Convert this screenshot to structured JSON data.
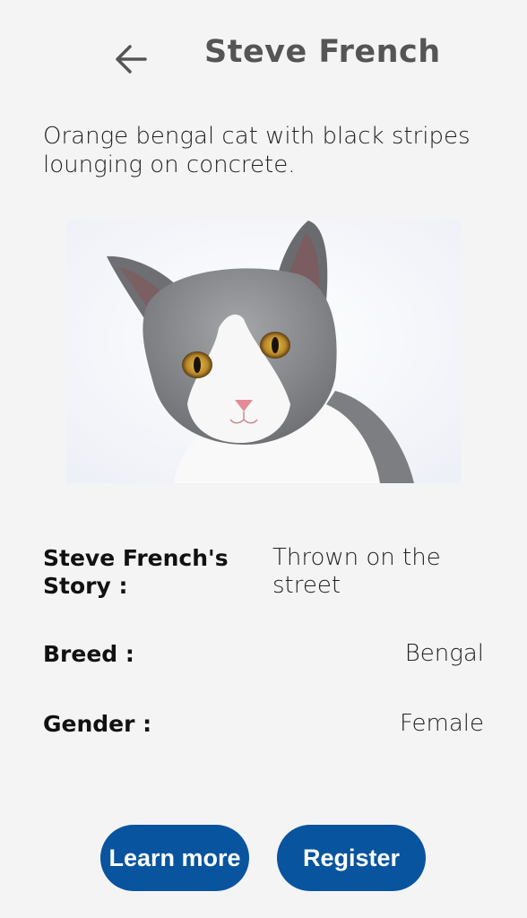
{
  "header": {
    "back_icon": "arrow-left-icon",
    "title": "Steve French"
  },
  "description": "Orange bengal cat with black stripes lounging on concrete.",
  "photo": {
    "subject": "cat-photo"
  },
  "details": {
    "story_label": "Steve French's Story :",
    "story_value": "Thrown on the street",
    "breed_label": "Breed :",
    "breed_value": "Bengal",
    "gender_label": "Gender :",
    "gender_value": "Female"
  },
  "actions": {
    "learn_more_label": "Learn more",
    "register_label": "Register"
  },
  "colors": {
    "background": "#f4f4f4",
    "button": "#08549e",
    "title": "#555555"
  }
}
